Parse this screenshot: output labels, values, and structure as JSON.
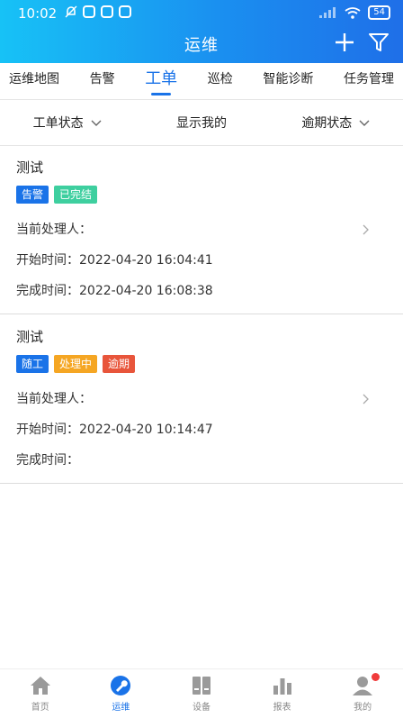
{
  "status_bar": {
    "time": "10:02",
    "battery": "54"
  },
  "header": {
    "title": "运维"
  },
  "tabs": [
    {
      "label": "运维地图"
    },
    {
      "label": "告警"
    },
    {
      "label": "工单"
    },
    {
      "label": "巡检"
    },
    {
      "label": "智能诊断"
    },
    {
      "label": "任务管理"
    }
  ],
  "active_tab": "工单",
  "filters": [
    {
      "label": "工单状态"
    },
    {
      "label": "显示我的"
    },
    {
      "label": "逾期状态"
    }
  ],
  "work_orders": [
    {
      "title": "测试",
      "tags": [
        {
          "text": "告警",
          "color": "#1a73e8"
        },
        {
          "text": "已完结",
          "color": "#3ecf9f"
        }
      ],
      "handler_label": "当前处理人：",
      "handler": "",
      "start_label": "开始时间：",
      "start_time": "2022-04-20 16:04:41",
      "end_label": "完成时间：",
      "end_time": "2022-04-20 16:08:38"
    },
    {
      "title": "测试",
      "tags": [
        {
          "text": "随工",
          "color": "#1a73e8"
        },
        {
          "text": "处理中",
          "color": "#f5a623"
        },
        {
          "text": "逾期",
          "color": "#e8553b"
        }
      ],
      "handler_label": "当前处理人：",
      "handler": "",
      "start_label": "开始时间：",
      "start_time": "2022-04-20 10:14:47",
      "end_label": "完成时间：",
      "end_time": ""
    }
  ],
  "bottom_nav": [
    {
      "label": "首页",
      "icon": "home-icon"
    },
    {
      "label": "运维",
      "icon": "wrench-icon"
    },
    {
      "label": "设备",
      "icon": "device-icon"
    },
    {
      "label": "报表",
      "icon": "chart-icon"
    },
    {
      "label": "我的",
      "icon": "user-icon"
    }
  ],
  "colors": {
    "accent": "#1a73e8",
    "header_start": "#17c2f6",
    "header_end": "#1f6fe8"
  }
}
